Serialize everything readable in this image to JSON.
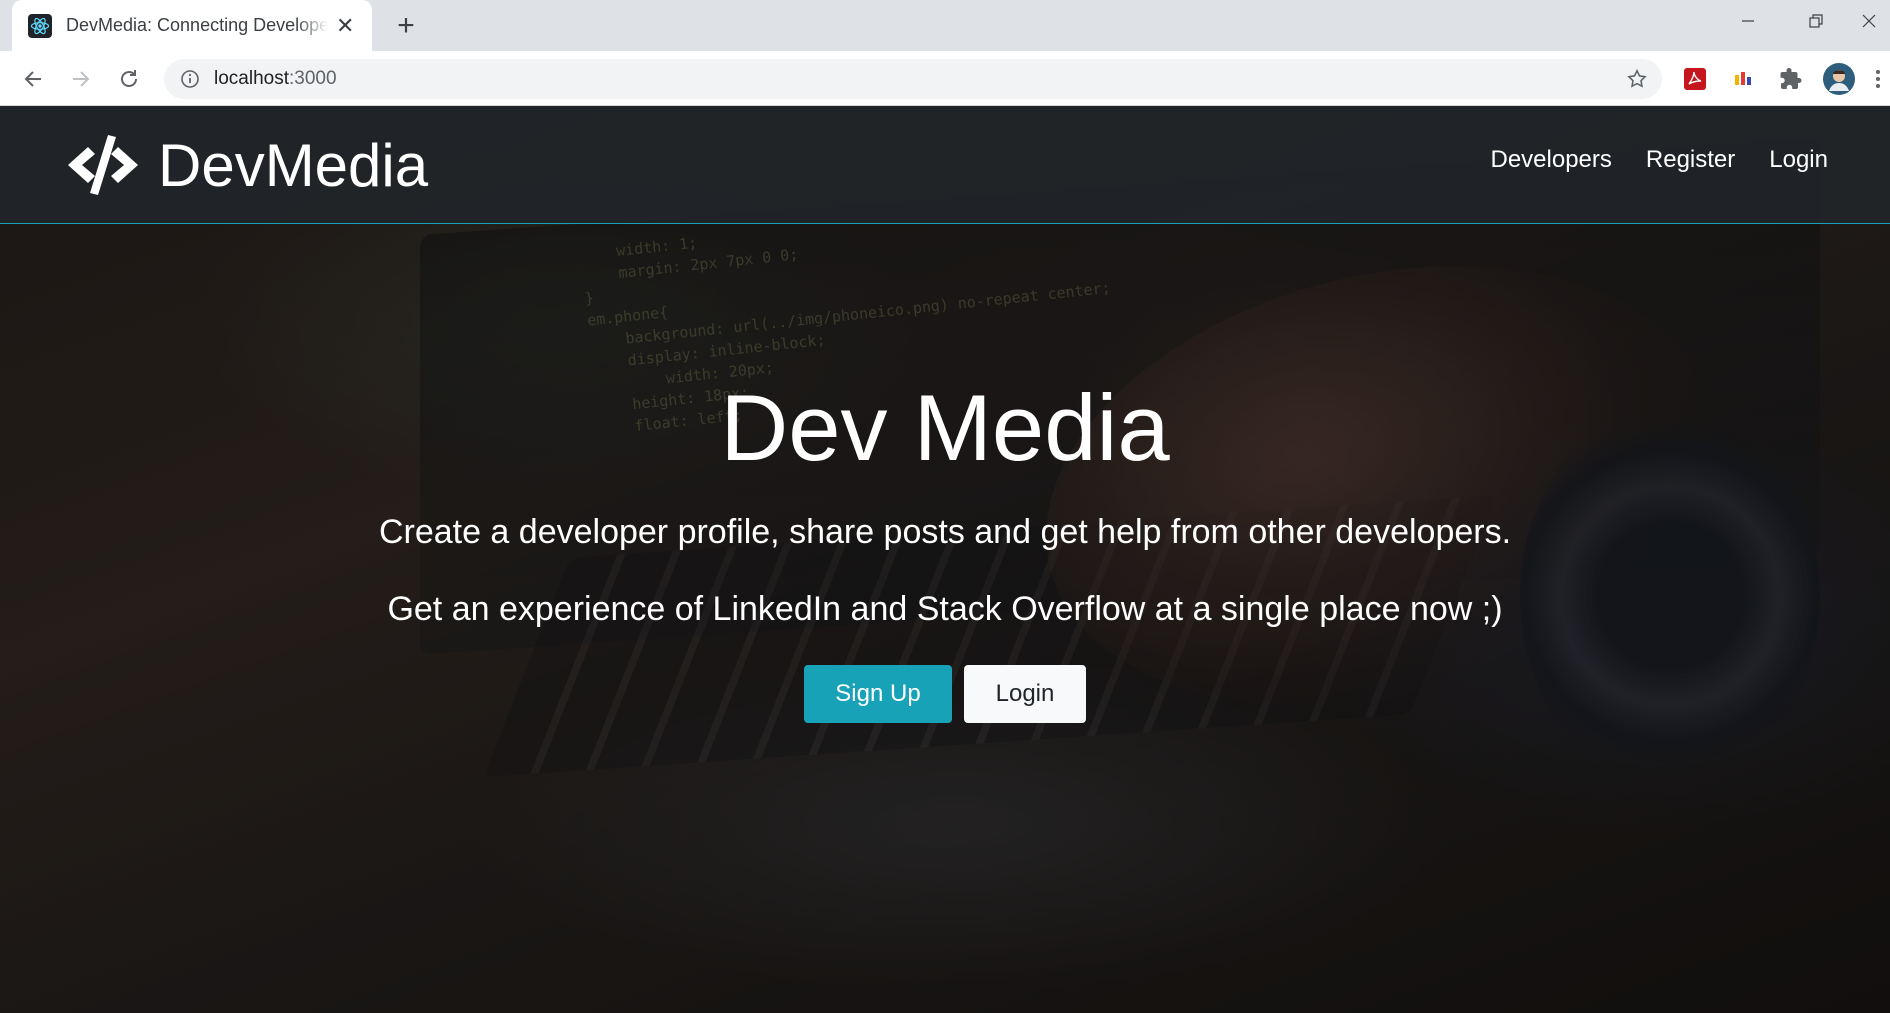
{
  "browser": {
    "tab": {
      "title": "DevMedia: Connecting Developers",
      "favicon": "react-icon"
    },
    "new_tab_label": "+",
    "address": {
      "host": "localhost",
      "port": ":3000"
    },
    "icons": {
      "back": "back-arrow-icon",
      "forward": "forward-arrow-icon",
      "reload": "reload-icon",
      "info": "info-icon",
      "bookmark": "star-icon",
      "extensions": [
        "pdf-extension-icon",
        "color-extension-icon",
        "puzzle-extensions-icon",
        "profile-avatar"
      ],
      "menu": "kebab-menu-icon"
    }
  },
  "navbar": {
    "brand": "DevMedia",
    "links": [
      "Developers",
      "Register",
      "Login"
    ]
  },
  "hero": {
    "title": "Dev Media",
    "lead": "Create a developer profile, share posts and get help from other developers.",
    "lead2": "Get an experience of LinkedIn and Stack Overflow at a single place now ;)",
    "signup_label": "Sign Up",
    "login_label": "Login"
  },
  "colors": {
    "accent": "#17a2b8",
    "navbar": "#212529",
    "light_button": "#f8f9fa"
  }
}
